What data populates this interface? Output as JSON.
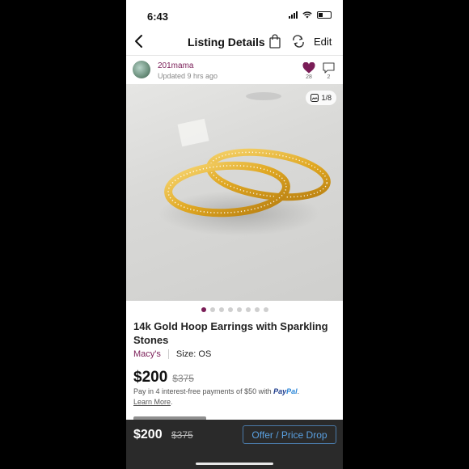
{
  "status_bar": {
    "time": "6:43"
  },
  "nav": {
    "title": "Listing Details",
    "edit_label": "Edit"
  },
  "seller": {
    "username": "201mama",
    "updated": "Updated 9 hrs ago"
  },
  "social": {
    "likes": "28",
    "comments": "2"
  },
  "gallery": {
    "counter": "1/8",
    "total_dots": 8,
    "active_index": 0
  },
  "listing": {
    "title": "14k Gold Hoop Earrings with Sparkling Stones",
    "brand": "Macy's",
    "size": "Size: OS",
    "price": "$200",
    "original_price": "$375"
  },
  "paypal": {
    "text": "Pay in 4 interest-free payments of $50 with ",
    "brand_pay": "Pay",
    "brand_pal": "Pal",
    "period": ".",
    "learn_more": "Learn More",
    "learn_more_suffix": "."
  },
  "bottom_bar": {
    "price": "$200",
    "original_price": "$375",
    "offer_button": "Offer / Price Drop"
  },
  "colors": {
    "accent": "#7a1d57",
    "offer_blue": "#5aa0e0",
    "bar_bg": "#2a2a2a"
  }
}
